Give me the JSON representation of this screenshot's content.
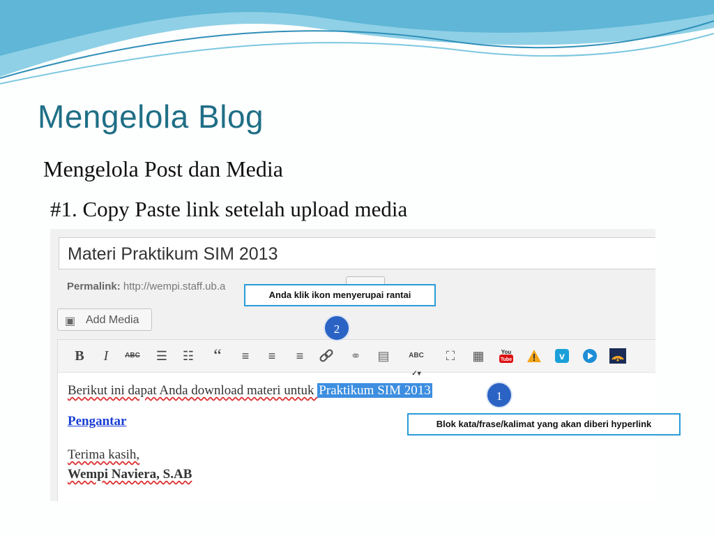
{
  "slide": {
    "title": "Mengelola Blog",
    "subtitle": "Mengelola Post dan Media",
    "step": "#1. Copy Paste link setelah upload media"
  },
  "editor": {
    "post_title": "Materi Praktikum SIM 2013",
    "permalink_label": "Permalink:",
    "permalink_url": "http://wempi.staff.ub.a",
    "add_media_label": "Add Media",
    "toolbar": [
      "bold-icon",
      "italic-icon",
      "strikethrough-icon",
      "bullet-list-icon",
      "numbered-list-icon",
      "blockquote-icon",
      "align-left-icon",
      "align-center-icon",
      "align-right-icon",
      "link-icon",
      "unlink-icon",
      "more-tag-icon",
      "spellcheck-icon",
      "fullscreen-icon",
      "kitchen-sink-icon",
      "youtube-icon",
      "warning-icon",
      "vimeo-icon",
      "play-icon",
      "wifi-icon"
    ],
    "content": {
      "line1_prefix": "Berikut ini dapat Anda download materi untuk ",
      "line1_highlight": "Praktikum SIM 2013",
      "link_text": "Pengantar",
      "thanks": "Terima kasih,",
      "signature": "Wempi Naviera, S.AB"
    }
  },
  "annotations": {
    "callout_link": "Anda klik ikon  menyerupai rantai",
    "callout_block": "Blok kata/frase/kalimat yang akan diberi hyperlink",
    "badge_1": "1",
    "badge_2": "2"
  },
  "colors": {
    "title": "#1f6f86",
    "callout_border": "#2a9bd8",
    "badge": "#2b63c4",
    "selection": "#3d8ee0"
  }
}
